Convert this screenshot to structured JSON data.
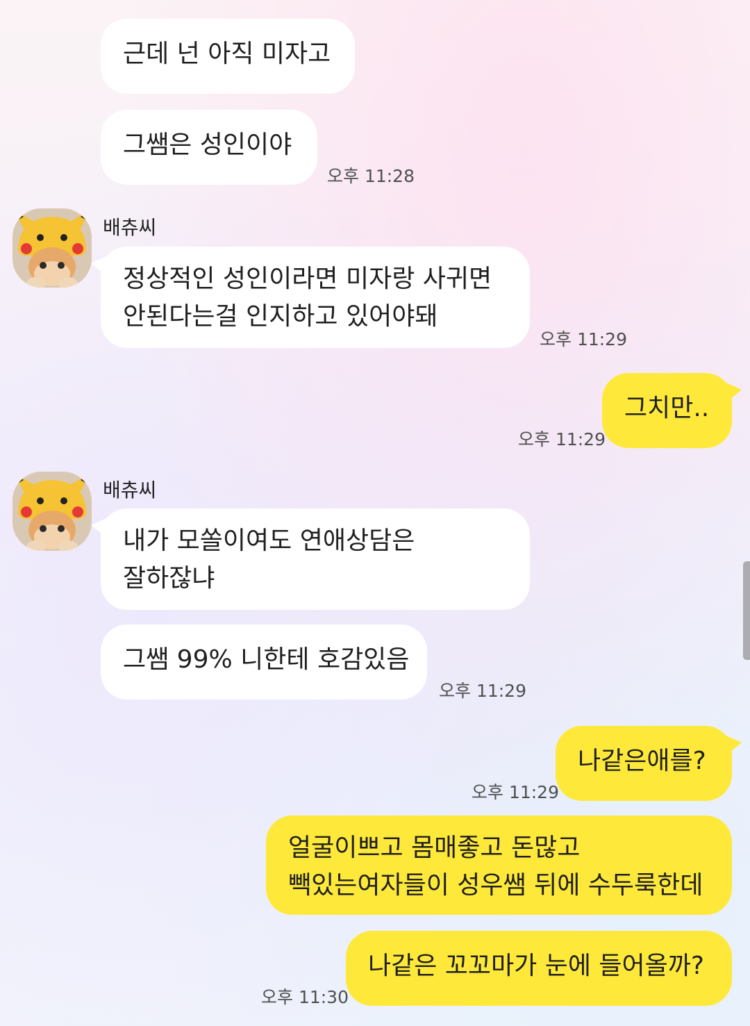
{
  "messages": [
    {
      "text": "근데 넌 아직 미자고"
    },
    {
      "text": "그쌤은 성인이야",
      "time": "오후 11:28"
    },
    {
      "sender": "배츄씨",
      "lines": [
        "정상적인 성인이라면 미자랑 사귀면",
        "안된다는걸 인지하고 있어야돼"
      ],
      "time": "오후 11:29"
    },
    {
      "text": "그치만..",
      "time": "오후 11:29"
    },
    {
      "sender": "배츄씨",
      "lines": [
        "내가 모쏠이여도 연애상담은",
        "잘하잖냐"
      ]
    },
    {
      "text": "그쌤 99% 니한테 호감있음",
      "time": "오후 11:29"
    },
    {
      "text": "나같은애를?",
      "time": "오후 11:29"
    },
    {
      "lines": [
        "얼굴이쁘고 몸매좋고 돈많고",
        "빽있는여자들이 성우쌤 뒤에 수두룩한데"
      ]
    },
    {
      "text": "나같은 꼬꼬마가 눈에 들어올까?",
      "time": "오후 11:30"
    }
  ],
  "colors": {
    "incoming_bubble": "#ffffff",
    "outgoing_bubble": "#fee93a",
    "time_text": "#4f4f4f"
  },
  "avatar_icon": "pikachu-hat-cat-avatar"
}
